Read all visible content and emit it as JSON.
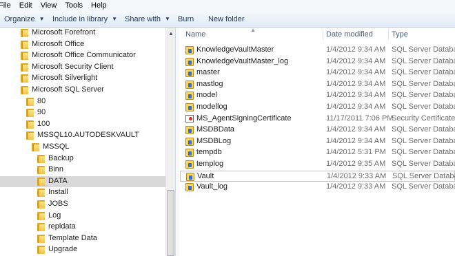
{
  "menu": [
    "File",
    "Edit",
    "View",
    "Tools",
    "Help"
  ],
  "toolbar": {
    "organize": "Organize",
    "include_in_library": "Include in library",
    "share_with": "Share with",
    "burn": "Burn",
    "new_folder": "New folder"
  },
  "nav_tree": [
    {
      "label": "Microsoft Forefront"
    },
    {
      "label": "Microsoft Office"
    },
    {
      "label": "Microsoft Office Communicator"
    },
    {
      "label": "Microsoft Security Client"
    },
    {
      "label": "Microsoft Silverlight"
    },
    {
      "label": "Microsoft SQL Server"
    },
    {
      "label": "80"
    },
    {
      "label": "90"
    },
    {
      "label": "100"
    },
    {
      "label": "MSSQL10.AUTODESKVAULT"
    },
    {
      "label": "MSSQL"
    },
    {
      "label": "Backup"
    },
    {
      "label": "Binn"
    },
    {
      "label": "DATA",
      "selected": true
    },
    {
      "label": "Install"
    },
    {
      "label": "JOBS"
    },
    {
      "label": "Log"
    },
    {
      "label": "repldata"
    },
    {
      "label": "Template Data"
    },
    {
      "label": "Upgrade"
    }
  ],
  "columns": {
    "name": "Name",
    "date_modified": "Date modified",
    "type": "Type"
  },
  "files": [
    {
      "name": "KnowledgeVaultMaster",
      "date": "1/4/2012 9:34 AM",
      "type": "SQL Server Databa...",
      "icon": "database-file-icon"
    },
    {
      "name": "KnowledgeVaultMaster_log",
      "date": "1/4/2012 9:34 AM",
      "type": "SQL Server Databa...",
      "icon": "database-file-icon"
    },
    {
      "name": "master",
      "date": "1/4/2012 9:34 AM",
      "type": "SQL Server Databa...",
      "icon": "database-file-icon"
    },
    {
      "name": "mastlog",
      "date": "1/4/2012 9:34 AM",
      "type": "SQL Server Databa...",
      "icon": "database-file-icon"
    },
    {
      "name": "model",
      "date": "1/4/2012 9:34 AM",
      "type": "SQL Server Databa...",
      "icon": "database-file-icon"
    },
    {
      "name": "modellog",
      "date": "1/4/2012 9:34 AM",
      "type": "SQL Server Databa...",
      "icon": "database-file-icon"
    },
    {
      "name": "MS_AgentSigningCertificate",
      "date": "11/17/2011 7:06 PM",
      "type": "Security Certificate",
      "icon": "certificate-icon"
    },
    {
      "name": "MSDBData",
      "date": "1/4/2012 9:34 AM",
      "type": "SQL Server Databa...",
      "icon": "database-file-icon"
    },
    {
      "name": "MSDBLog",
      "date": "1/4/2012 9:34 AM",
      "type": "SQL Server Databa...",
      "icon": "database-file-icon"
    },
    {
      "name": "tempdb",
      "date": "1/4/2012 5:31 PM",
      "type": "SQL Server Databa...",
      "icon": "database-file-icon"
    },
    {
      "name": "templog",
      "date": "1/4/2012 9:35 AM",
      "type": "SQL Server Databa...",
      "icon": "database-file-icon"
    },
    {
      "name": "Vault",
      "date": "1/4/2012 9:33 AM",
      "type": "SQL Server Databa...",
      "icon": "database-file-icon",
      "selected": true
    },
    {
      "name": "Vault_log",
      "date": "1/4/2012 9:33 AM",
      "type": "SQL Server Databa...",
      "icon": "database-file-icon"
    }
  ]
}
